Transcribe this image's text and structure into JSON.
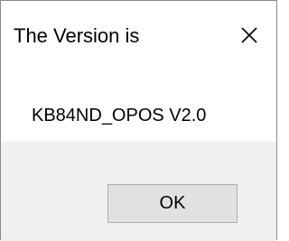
{
  "dialog": {
    "title": "The Version is",
    "close_icon": "close-icon",
    "message": "KB84ND_OPOS V2.0",
    "ok_label": "OK"
  },
  "colors": {
    "footer_background": "#f0f0f0",
    "button_background": "#e1e1e1",
    "button_border": "#adadad"
  }
}
